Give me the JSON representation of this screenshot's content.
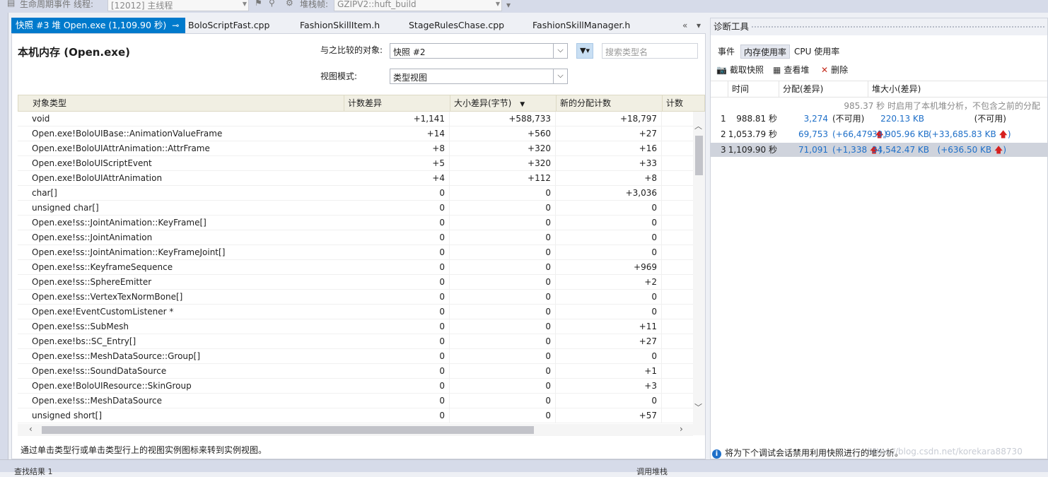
{
  "topbar": {
    "lifecycle": "生命周期事件",
    "thread_label": "线程:",
    "thread_value": "[12012] 主线程",
    "stack_label": "堆栈帧:",
    "stack_value": "GZIPV2::huft_build"
  },
  "tabs": [
    {
      "label": "快照 #3 堆 Open.exe (1,109.90 秒)",
      "active": true
    },
    {
      "label": "BoloScriptFast.cpp"
    },
    {
      "label": "FashionSkillItem.h"
    },
    {
      "label": "StageRulesChase.cpp"
    },
    {
      "label": "FashionSkillManager.h"
    }
  ],
  "tab_controls": {
    "overflow": "«",
    "menu": "▾",
    "pin": "⊸",
    "close": "✕"
  },
  "doc": {
    "title": "本机内存 (Open.exe)",
    "compare_label": "与之比较的对象:",
    "compare_value": "快照 #2",
    "view_mode_label": "视图模式:",
    "view_mode_value": "类型视图",
    "search_placeholder": "搜索类型名",
    "hint": "通过单击类型行或单击类型行上的视图实例图标来转到实例视图。"
  },
  "grid": {
    "columns": [
      "对象类型",
      "计数差异",
      "大小差异(字节)",
      "新的分配计数",
      "计数"
    ],
    "rows": [
      {
        "name": "void",
        "count_diff": "+1,141",
        "size_diff": "+588,733",
        "new_alloc": "+18,797"
      },
      {
        "name": "Open.exe!BoloUIBase::AnimationValueFrame",
        "count_diff": "+14",
        "size_diff": "+560",
        "new_alloc": "+27"
      },
      {
        "name": "Open.exe!BoloUIAttrAnimation::AttrFrame",
        "count_diff": "+8",
        "size_diff": "+320",
        "new_alloc": "+16"
      },
      {
        "name": "Open.exe!BoloUIScriptEvent",
        "count_diff": "+5",
        "size_diff": "+320",
        "new_alloc": "+33"
      },
      {
        "name": "Open.exe!BoloUIAttrAnimation",
        "count_diff": "+4",
        "size_diff": "+112",
        "new_alloc": "+8"
      },
      {
        "name": "char[]",
        "count_diff": "0",
        "size_diff": "0",
        "new_alloc": "+3,036"
      },
      {
        "name": "unsigned char[]",
        "count_diff": "0",
        "size_diff": "0",
        "new_alloc": "0"
      },
      {
        "name": "Open.exe!ss::JointAnimation::KeyFrame[]",
        "count_diff": "0",
        "size_diff": "0",
        "new_alloc": "0"
      },
      {
        "name": "Open.exe!ss::JointAnimation",
        "count_diff": "0",
        "size_diff": "0",
        "new_alloc": "0"
      },
      {
        "name": "Open.exe!ss::JointAnimation::KeyFrameJoint[]",
        "count_diff": "0",
        "size_diff": "0",
        "new_alloc": "0"
      },
      {
        "name": "Open.exe!ss::KeyframeSequence",
        "count_diff": "0",
        "size_diff": "0",
        "new_alloc": "+969"
      },
      {
        "name": "Open.exe!ss::SphereEmitter",
        "count_diff": "0",
        "size_diff": "0",
        "new_alloc": "+2"
      },
      {
        "name": "Open.exe!ss::VertexTexNormBone[]",
        "count_diff": "0",
        "size_diff": "0",
        "new_alloc": "0"
      },
      {
        "name": "Open.exe!EventCustomListener *",
        "count_diff": "0",
        "size_diff": "0",
        "new_alloc": "0"
      },
      {
        "name": "Open.exe!ss::SubMesh",
        "count_diff": "0",
        "size_diff": "0",
        "new_alloc": "+11"
      },
      {
        "name": "Open.exe!bs::SC_Entry[]",
        "count_diff": "0",
        "size_diff": "0",
        "new_alloc": "+27"
      },
      {
        "name": "Open.exe!ss::MeshDataSource::Group[]",
        "count_diff": "0",
        "size_diff": "0",
        "new_alloc": "0"
      },
      {
        "name": "Open.exe!ss::SoundDataSource",
        "count_diff": "0",
        "size_diff": "0",
        "new_alloc": "+1"
      },
      {
        "name": "Open.exe!BoloUIResource::SkinGroup",
        "count_diff": "0",
        "size_diff": "0",
        "new_alloc": "+3"
      },
      {
        "name": "Open.exe!ss::MeshDataSource",
        "count_diff": "0",
        "size_diff": "0",
        "new_alloc": "0"
      },
      {
        "name": "unsigned short[]",
        "count_diff": "0",
        "size_diff": "0",
        "new_alloc": "+57"
      }
    ]
  },
  "bottom": {
    "find_results": "查找结果 1",
    "call_stack": "调用堆栈"
  },
  "diag": {
    "title": "诊断工具",
    "tabs": [
      "事件",
      "内存使用率",
      "CPU 使用率"
    ],
    "tools": {
      "snapshot": "截取快照",
      "view_heap": "查看堆",
      "delete": "删除"
    },
    "columns": [
      "时间",
      "分配(差异)",
      "堆大小(差异)"
    ],
    "note": "985.37 秒 时启用了本机堆分析，不包含之前的分配",
    "snapshots": [
      {
        "id": "1",
        "time": "988.81 秒",
        "alloc": "3,274",
        "alloc_diff": "(不可用)",
        "heap": "220.13 KB",
        "heap_diff": "(不可用)"
      },
      {
        "id": "2",
        "time": "1,053.79 秒",
        "alloc": "69,753",
        "alloc_diff": "(+66,479",
        "heap": "33,905.96 KB",
        "heap_diff": "(+33,685.83 KB"
      },
      {
        "id": "3",
        "time": "1,109.90 秒",
        "alloc": "71,091",
        "alloc_diff": "(+1,338",
        "heap": "34,542.47 KB",
        "heap_diff": "(+636.50 KB"
      }
    ],
    "info": "将为下个调试会话禁用利用快照进行的堆分析。",
    "watermark": "https://blog.csdn.net/korekara88730"
  }
}
